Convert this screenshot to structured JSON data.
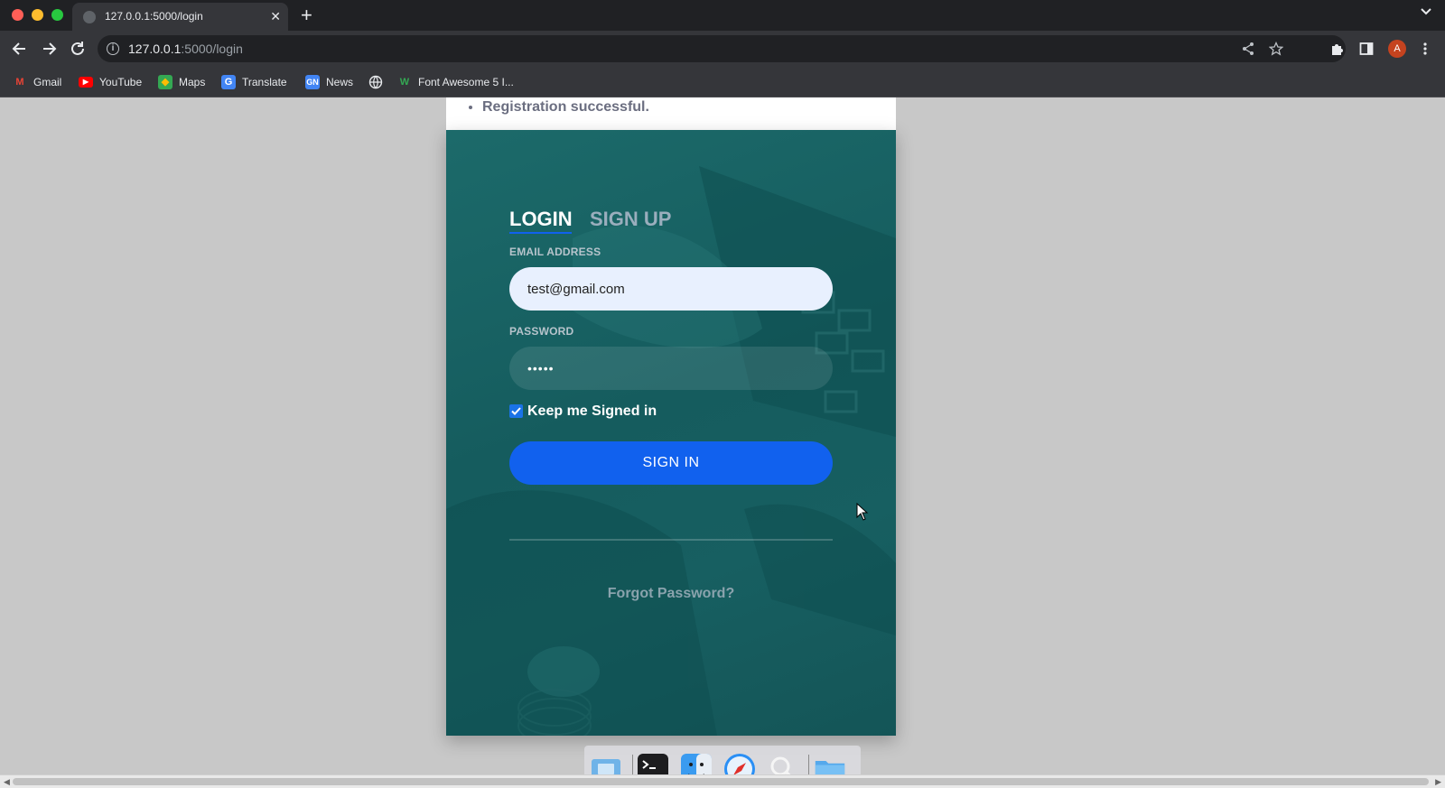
{
  "browser": {
    "tab_title": "127.0.0.1:5000/login",
    "tab_close": "✕",
    "new_tab": "+",
    "url_host": "127.0.0.1",
    "url_path": ":5000/login",
    "profile_initial": "A",
    "colors": {
      "close": "#ff5f57",
      "minimize": "#febc2e",
      "maximize": "#28c840"
    }
  },
  "bookmarks": [
    {
      "label": "Gmail",
      "icon": "gmail-icon"
    },
    {
      "label": "YouTube",
      "icon": "youtube-icon"
    },
    {
      "label": "Maps",
      "icon": "maps-icon"
    },
    {
      "label": "Translate",
      "icon": "translate-icon"
    },
    {
      "label": "News",
      "icon": "news-icon"
    },
    {
      "label": "",
      "icon": "globe-icon"
    },
    {
      "label": "Font Awesome 5 I...",
      "icon": "font-awesome-icon"
    }
  ],
  "flash": {
    "message": "Registration successful."
  },
  "login": {
    "tab_login": "LOGIN",
    "tab_signup": "SIGN UP",
    "email_label": "EMAIL ADDRESS",
    "email_value": "test@gmail.com",
    "password_label": "PASSWORD",
    "password_value": "•••••",
    "keep_signed_in": "Keep me Signed in",
    "keep_signed_in_checked": true,
    "sign_in_button": "SIGN IN",
    "forgot_password": "Forgot Password?"
  },
  "dock": [
    {
      "icon": "desktop-folder-icon"
    },
    {
      "icon": "terminal-icon"
    },
    {
      "icon": "finder-icon"
    },
    {
      "icon": "safari-icon"
    },
    {
      "icon": "search-icon"
    },
    {
      "icon": "folder-icon"
    }
  ]
}
